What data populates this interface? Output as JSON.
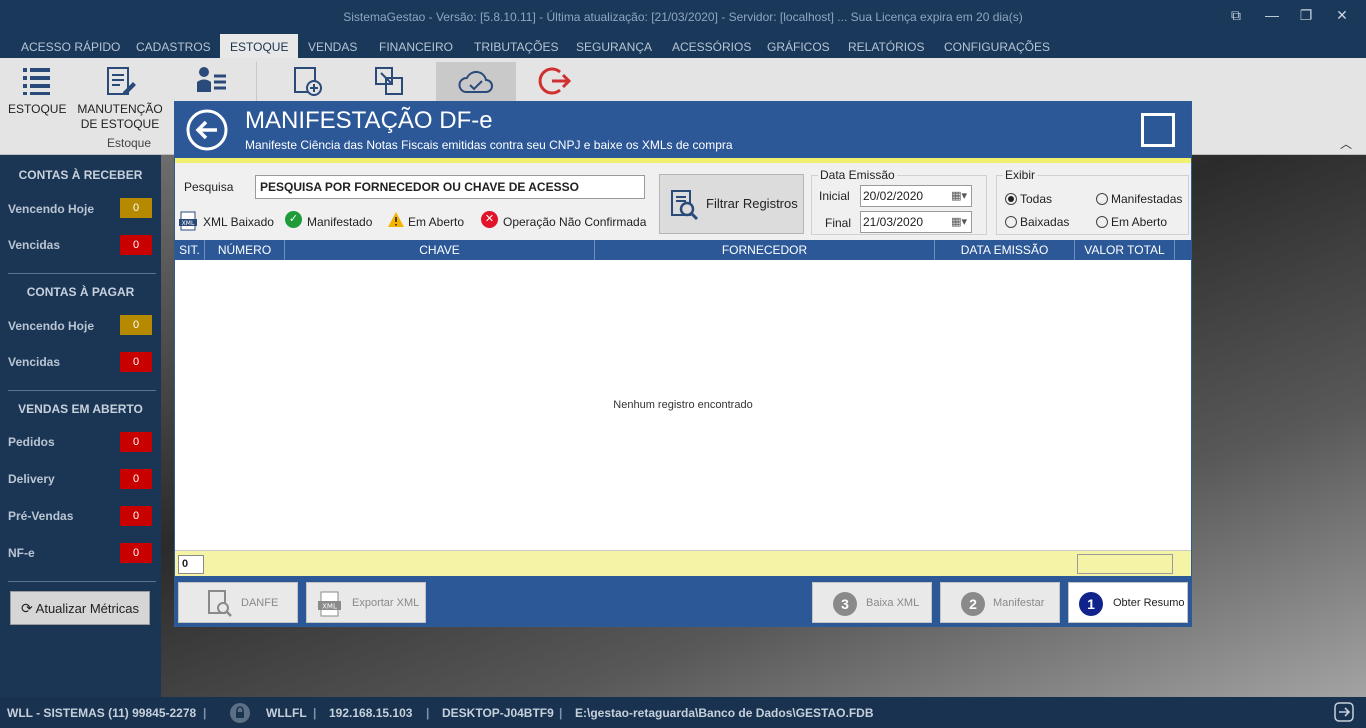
{
  "window": {
    "title": "SistemaGestao - Versão: [5.8.10.11] - Última atualização: [21/03/2020] - Servidor: [localhost] ... Sua Licença expira em 20 dia(s)",
    "controls": [
      "restore-icon",
      "minimize-icon",
      "maximize-icon",
      "close-icon"
    ]
  },
  "menu": {
    "tabs": [
      "ACESSO RÁPIDO",
      "CADASTROS",
      "ESTOQUE",
      "VENDAS",
      "FINANCEIRO",
      "TRIBUTAÇÕES",
      "SEGURANÇA",
      "ACESSÓRIOS",
      "GRÁFICOS",
      "RELATÓRIOS",
      "CONFIGURAÇÕES"
    ],
    "active": "ESTOQUE"
  },
  "ribbon": {
    "buttons": [
      {
        "line1": "ESTOQUE",
        "line2": "",
        "icon": "list-icon"
      },
      {
        "line1": "MANUTENÇÃO",
        "line2": "DE ESTOQUE",
        "icon": "edit-doc-icon"
      }
    ],
    "group_label": "Estoque"
  },
  "sidebar": {
    "receber": {
      "title": "CONTAS À RECEBER",
      "vencendo": "Vencendo Hoje",
      "vencendo_val": "0",
      "vencidas": "Vencidas",
      "vencidas_val": "0"
    },
    "pagar": {
      "title": "CONTAS À PAGAR",
      "vencendo": "Vencendo Hoje",
      "vencendo_val": "0",
      "vencidas": "Vencidas",
      "vencidas_val": "0"
    },
    "vendas": {
      "title": "VENDAS EM ABERTO",
      "pedidos": "Pedidos",
      "pedidos_val": "0",
      "delivery": "Delivery",
      "delivery_val": "0",
      "prevendas": "Pré-Vendas",
      "prevendas_val": "0",
      "nfe": "NF-e",
      "nfe_val": "0"
    },
    "refresh_label": "Atualizar Métricas"
  },
  "dialog": {
    "title": "MANIFESTAÇÃO DF-e",
    "subtitle": "Manifeste Ciência das Notas Fiscais emitidas contra seu CNPJ e baixe os XMLs de compra",
    "search_label": "Pesquisa",
    "search_value": "PESQUISA POR FORNECEDOR OU CHAVE DE ACESSO",
    "legend": {
      "xml": "XML Baixado",
      "manifestado": "Manifestado",
      "aberto": "Em Aberto",
      "nao_confirmada": "Operação Não Confirmada"
    },
    "filter_button": "Filtrar Registros",
    "data_emissao": {
      "legend": "Data Emissão",
      "inicial_label": "Inicial",
      "inicial": "20/02/2020",
      "final_label": "Final",
      "final": "21/03/2020"
    },
    "exibir": {
      "legend": "Exibir",
      "todas": "Todas",
      "manifestadas": "Manifestadas",
      "baixadas": "Baixadas",
      "em_aberto": "Em Aberto",
      "selected": "Todas"
    },
    "columns": [
      "SIT.",
      "NÚMERO",
      "CHAVE",
      "FORNECEDOR",
      "DATA EMISSÃO",
      "VALOR TOTAL"
    ],
    "rows": [],
    "empty_message": "Nenhum registro encontrado",
    "count": "0",
    "actions": {
      "danfe": "DANFE",
      "exportar": "Exportar XML",
      "baixa_num": "3",
      "baixa": "Baixa XML",
      "manifestar_num": "2",
      "manifestar": "Manifestar",
      "resumo_num": "1",
      "resumo": "Obter Resumo"
    }
  },
  "status": {
    "company": "WLL - SISTEMAS (11) 99845-2278",
    "user": "WLLFL",
    "ip": "192.168.15.103",
    "host": "DESKTOP-J04BTF9",
    "db": "E:\\gestao-retaguarda\\Banco de Dados\\GESTAO.FDB"
  },
  "colors": {
    "title_bg": "#19385a",
    "dialog_header": "#2c5898",
    "yellow_accent": "#f1f06e",
    "badge_yellow": "#b58a00",
    "badge_red": "#c90000",
    "ok_green": "#1f9b3a"
  }
}
